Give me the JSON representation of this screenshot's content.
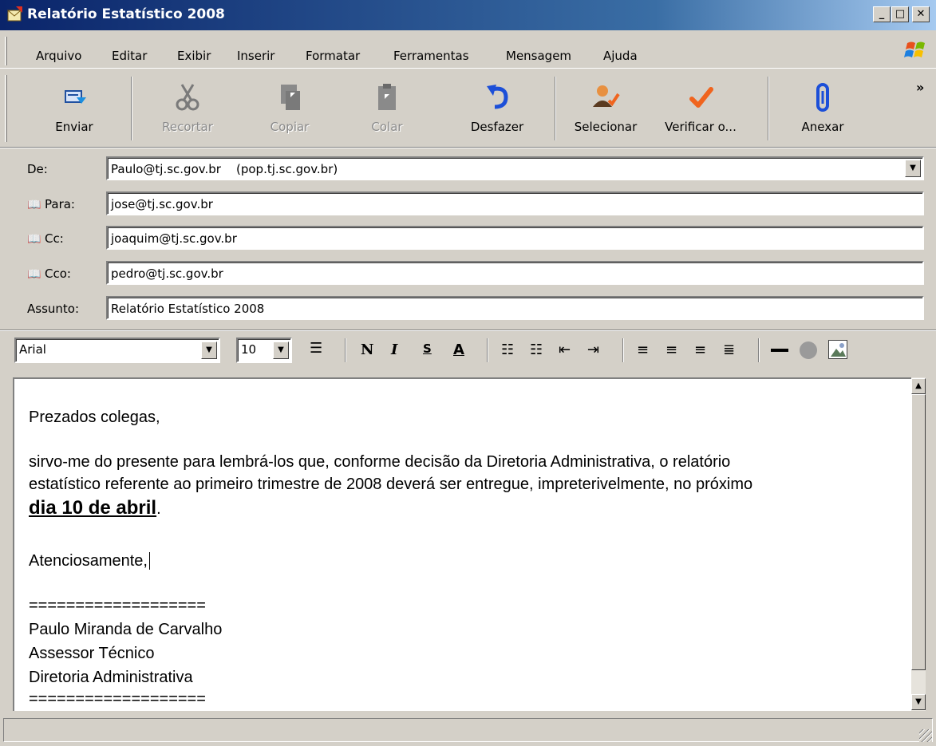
{
  "window": {
    "title": "Relatório Estatístico 2008"
  },
  "menu": [
    "Arquivo",
    "Editar",
    "Exibir",
    "Inserir",
    "Formatar",
    "Ferramentas",
    "Mensagem",
    "Ajuda"
  ],
  "toolbar": {
    "send": "Enviar",
    "cut": "Recortar",
    "copy": "Copiar",
    "paste": "Colar",
    "undo": "Desfazer",
    "select": "Selecionar",
    "check": "Verificar o...",
    "attach": "Anexar",
    "more": "»"
  },
  "headers": {
    "from_label": "De:",
    "from_value": "Paulo@tj.sc.gov.br    (pop.tj.sc.gov.br)",
    "to_label": "Para:",
    "to_value": "jose@tj.sc.gov.br",
    "cc_label": "Cc:",
    "cc_value": "joaquim@tj.sc.gov.br",
    "bcc_label": "Cco:",
    "bcc_value": "pedro@tj.sc.gov.br",
    "subject_label": "Assunto:",
    "subject_value": "Relatório Estatístico 2008"
  },
  "format": {
    "font": "Arial",
    "size": "10",
    "bold": "N",
    "italic": "I",
    "underline": "S",
    "color": "A"
  },
  "body": {
    "greeting": "Prezados colegas,",
    "p1_line1": "sirvo-me do presente para lembrá-los que, conforme decisão da Diretoria Administrativa, o relatório",
    "p1_line2": "estatístico referente ao primeiro trimestre de 2008 deverá ser entregue, impreterivelmente, no próximo",
    "deadline": "dia 10 de abril",
    "period": ".",
    "closing": "Atenciosamente,",
    "rule1": "===================",
    "sig_name": "Paulo Miranda de Carvalho",
    "sig_role": "Assessor Técnico",
    "sig_dept": "Diretoria Administrativa",
    "rule2": "==================="
  },
  "colors": {
    "title_start": "#0a246a",
    "title_end": "#a6caf0",
    "face": "#d4d0c8",
    "check": "#f0641e",
    "undo": "#1c4fd8"
  }
}
